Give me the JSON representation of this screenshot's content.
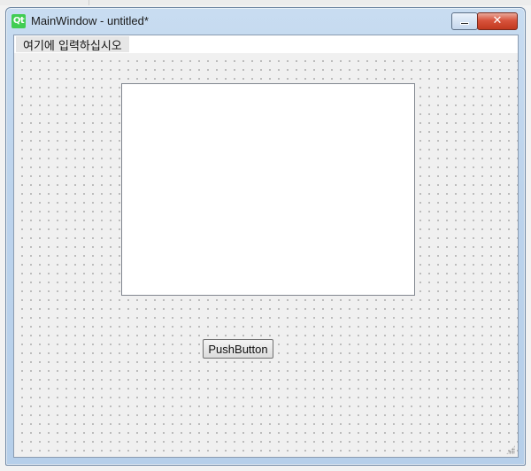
{
  "window": {
    "logo_text": "Qt",
    "title": "MainWindow - untitled*"
  },
  "titlebar_buttons": {
    "minimize_icon": "minimize-icon",
    "close_symbol": "✕"
  },
  "menubar": {
    "placeholder": "여기에 입력하십시오"
  },
  "form": {
    "push_button_label": "PushButton"
  },
  "colors": {
    "frame": "#bcd3ec",
    "close_button": "#c8442b",
    "qt_green": "#41cd52"
  }
}
